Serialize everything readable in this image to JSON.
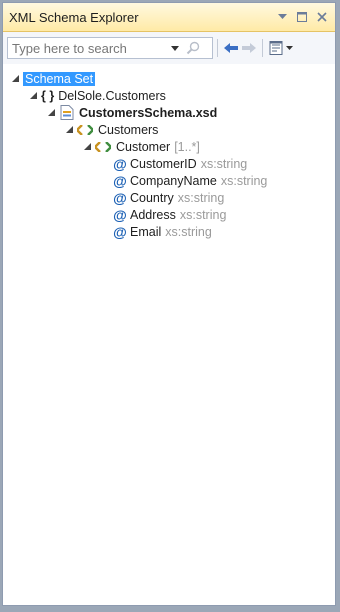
{
  "window": {
    "title": "XML Schema Explorer"
  },
  "toolbar": {
    "search_placeholder": "Type here to search"
  },
  "tree": {
    "root": {
      "label": "Schema Set"
    },
    "namespace": {
      "label": "DelSole.Customers",
      "icon": "namespace-braces-icon"
    },
    "file": {
      "label": "CustomersSchema.xsd",
      "icon": "xsd-file-icon"
    },
    "element": {
      "label": "Customers",
      "icon": "element-icon"
    },
    "child": {
      "label": "Customer",
      "multiplicity": "[1..*]",
      "icon": "element-icon"
    },
    "attributes": [
      {
        "name": "CustomerID",
        "type": "xs:string"
      },
      {
        "name": "CompanyName",
        "type": "xs:string"
      },
      {
        "name": "Country",
        "type": "xs:string"
      },
      {
        "name": "Address",
        "type": "xs:string"
      },
      {
        "name": "Email",
        "type": "xs:string"
      }
    ]
  },
  "colors": {
    "selection": "#3399ff",
    "title_bar": "#ffeaa6",
    "attribute_icon": "#1a5fb4",
    "type_text": "#9a9a9a"
  }
}
